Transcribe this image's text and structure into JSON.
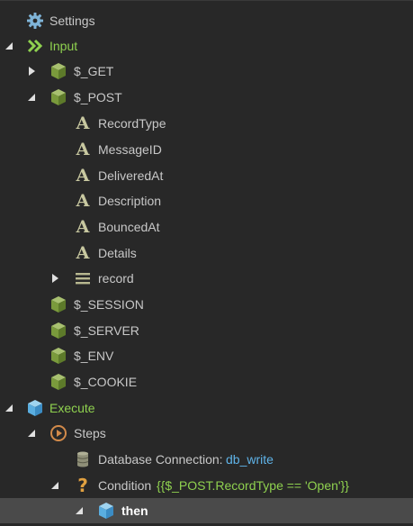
{
  "tree": {
    "settings": "Settings",
    "input": "Input",
    "get": "$_GET",
    "post": "$_POST",
    "fields": [
      "RecordType",
      "MessageID",
      "DeliveredAt",
      "Description",
      "BouncedAt",
      "Details"
    ],
    "record": "record",
    "session": "$_SESSION",
    "server": "$_SERVER",
    "env": "$_ENV",
    "cookie": "$_COOKIE",
    "execute": "Execute",
    "steps": "Steps",
    "db_label": "Database Connection:",
    "db_value": "db_write",
    "cond_label": "Condition",
    "cond_value": "{{$_POST.RecordType == 'Open'}}",
    "then": "then"
  },
  "icons": {
    "settings": "gear-icon",
    "input": "double-chevron-icon",
    "variable": "cube-icon",
    "field": "letter-a-icon",
    "array": "list-icon",
    "execute": "cube-icon",
    "steps": "play-circle-icon",
    "database": "database-icon",
    "condition": "question-icon",
    "then": "cube-icon"
  },
  "colors": {
    "background": "#282828",
    "text": "#c8c8c8",
    "accent_green": "#8fd14f",
    "link_blue": "#5fb3e8",
    "selected_row": "#4a4a4a"
  }
}
